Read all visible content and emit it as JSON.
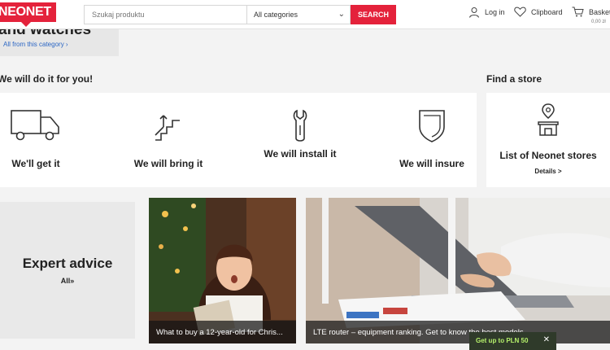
{
  "header": {
    "logo": "NEONET",
    "search_placeholder": "Szukaj produktu",
    "category_select": "All categories",
    "search_button": "SEARCH",
    "login": "Log in",
    "clipboard": "Clipboard",
    "basket": "Basket",
    "basket_amount": "0,00 zł"
  },
  "category_card": {
    "title": "and watches",
    "link": "All from this category ›"
  },
  "services": {
    "title": "We will do it for you!",
    "items": [
      {
        "label": "We'll get it",
        "icon": "truck-icon"
      },
      {
        "label": "We will bring it",
        "icon": "stairs-icon"
      },
      {
        "label": "We will install it",
        "icon": "wrench-icon"
      },
      {
        "label": "We will insure",
        "icon": "shield-icon"
      }
    ]
  },
  "store": {
    "title": "Find a store",
    "label": "List of Neonet stores",
    "details": "Details >",
    "icon": "store-pin-icon"
  },
  "expert": {
    "title": "Expert advice",
    "all": "All»"
  },
  "tiles": [
    {
      "caption": "What to buy a 12-year-old for Chris..."
    },
    {
      "caption": "LTE router – equipment ranking. Get to know the best models"
    }
  ],
  "promo": {
    "text": "Get up to PLN 50",
    "close": "✕"
  }
}
